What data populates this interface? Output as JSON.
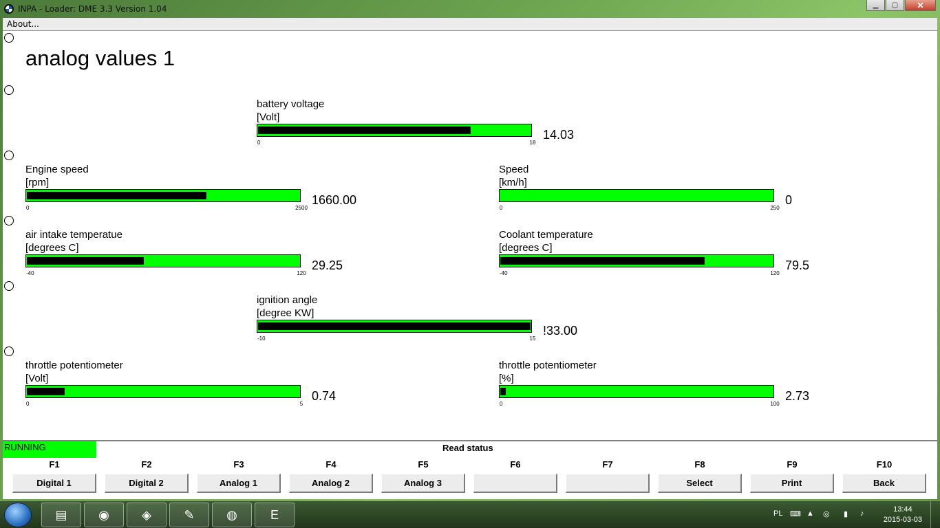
{
  "window": {
    "title": "INPA - Loader:  DME 3.3 Version 1.04"
  },
  "menu": {
    "about": "About..."
  },
  "page": {
    "title": "analog values 1"
  },
  "gauges": [
    {
      "label": "battery voltage",
      "unit": "[Volt]",
      "min": "0",
      "max": "18",
      "value": "14.03",
      "fill_fraction": 0.78
    },
    {
      "label": "Engine speed",
      "unit": "[rpm]",
      "min": "0",
      "max": "2500",
      "value": "1660.00",
      "fill_fraction": 0.66
    },
    {
      "label": "Speed",
      "unit": "[km/h]",
      "min": "0",
      "max": "250",
      "value": "0",
      "fill_fraction": 0.0
    },
    {
      "label": "air intake temperatue",
      "unit": "[degrees C]",
      "min": "-40",
      "max": "120",
      "value": "29.25",
      "fill_fraction": 0.43
    },
    {
      "label": "Coolant temperature",
      "unit": "[degrees C]",
      "min": "-40",
      "max": "120",
      "value": "79.5",
      "fill_fraction": 0.75
    },
    {
      "label": "ignition angle",
      "unit": "[degree KW]",
      "min": "-10",
      "max": "15",
      "value": "!33.00",
      "fill_fraction": 1.0
    },
    {
      "label": "throttle potentiometer",
      "unit": "[Volt]",
      "min": "0",
      "max": "5",
      "value": "0.74",
      "fill_fraction": 0.14
    },
    {
      "label": "throttle potentiometer",
      "unit": "[%]",
      "min": "0",
      "max": "100",
      "value": "2.73",
      "fill_fraction": 0.02
    }
  ],
  "status": {
    "running": "RUNNING",
    "read_status": "Read status"
  },
  "function_keys": [
    {
      "key": "F1",
      "label": "Digital 1"
    },
    {
      "key": "F2",
      "label": "Digital 2"
    },
    {
      "key": "F3",
      "label": "Analog 1"
    },
    {
      "key": "F4",
      "label": "Analog 2"
    },
    {
      "key": "F5",
      "label": "Analog 3"
    },
    {
      "key": "F6",
      "label": ""
    },
    {
      "key": "F7",
      "label": ""
    },
    {
      "key": "F8",
      "label": "Select"
    },
    {
      "key": "F9",
      "label": "Print"
    },
    {
      "key": "F10",
      "label": "Back"
    }
  ],
  "taskbar": {
    "language": "PL",
    "time": "13:44",
    "date": "2015-03-03",
    "apps": [
      "explorer-icon",
      "firefox-icon",
      "ediabas-icon",
      "paint-icon",
      "bmw-inpa-icon",
      "editor-icon"
    ]
  },
  "colors": {
    "bar_green": "#00ff00",
    "bar_fill": "#000000",
    "running_bg": "#00ff00"
  }
}
